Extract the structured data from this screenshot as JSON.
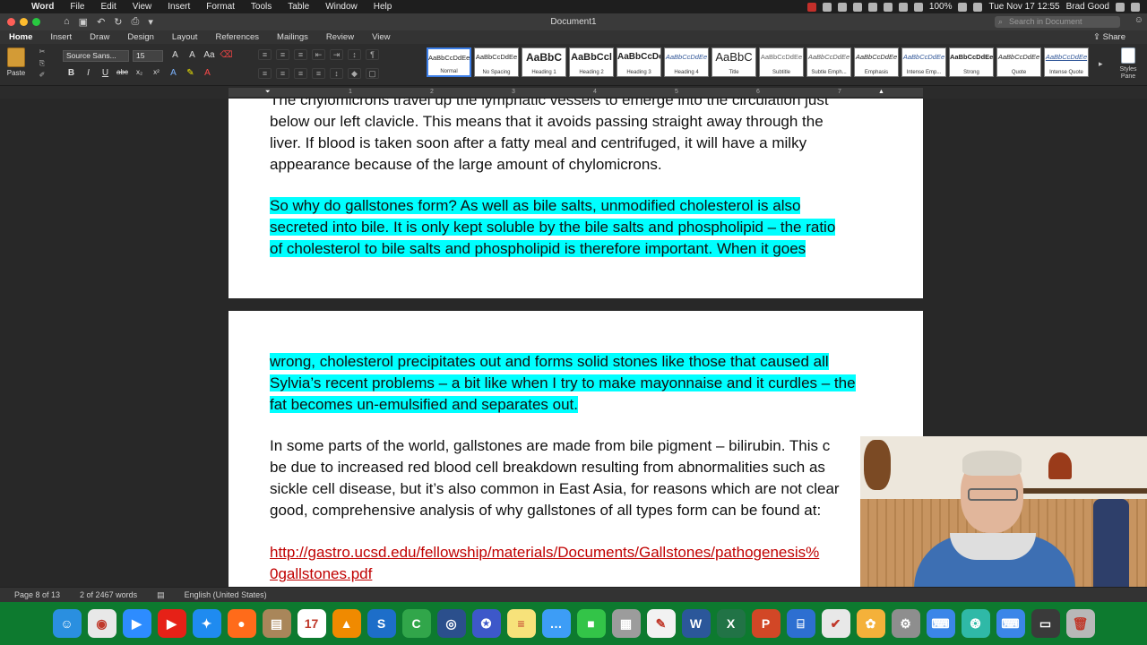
{
  "menubar": {
    "app": "Word",
    "items": [
      "File",
      "Edit",
      "View",
      "Insert",
      "Format",
      "Tools",
      "Table",
      "Window",
      "Help"
    ],
    "battery": "100%",
    "clock": "Tue Nov 17  12:55",
    "user": "Brad Good"
  },
  "titlebar": {
    "title": "Document1",
    "search_placeholder": "Search in Document"
  },
  "ribbon": {
    "tabs": [
      "Home",
      "Insert",
      "Draw",
      "Design",
      "Layout",
      "References",
      "Mailings",
      "Review",
      "View"
    ],
    "active_tab": "Home",
    "share": "Share",
    "paste": "Paste",
    "font_name": "Source Sans...",
    "font_size": "15",
    "format_buttons": [
      "B",
      "I",
      "U",
      "abc",
      "x₂",
      "x²",
      "A",
      "✎",
      "A"
    ],
    "styles": [
      {
        "sample": "AaBbCcDdEe",
        "name": "Normal"
      },
      {
        "sample": "AaBbCcDdEe",
        "name": "No Spacing"
      },
      {
        "sample": "AaBbC",
        "name": "Heading 1"
      },
      {
        "sample": "AaBbCcl",
        "name": "Heading 2"
      },
      {
        "sample": "AaBbCcDc",
        "name": "Heading 3"
      },
      {
        "sample": "AaBbCcDdEe",
        "name": "Heading 4"
      },
      {
        "sample": "AaBbC",
        "name": "Title"
      },
      {
        "sample": "AaBbCcDdEe",
        "name": "Subtitle"
      },
      {
        "sample": "AaBbCcDdEe",
        "name": "Subtle Emph..."
      },
      {
        "sample": "AaBbCcDdEe",
        "name": "Emphasis"
      },
      {
        "sample": "AaBbCcDdEe",
        "name": "Intense Emp..."
      },
      {
        "sample": "AaBbCcDdEe",
        "name": "Strong"
      },
      {
        "sample": "AaBbCcDdEe",
        "name": "Quote"
      },
      {
        "sample": "AaBbCcDdEe",
        "name": "Intense Quote"
      }
    ],
    "styles_pane": "Styles Pane"
  },
  "ruler": {
    "ticks": [
      "1",
      "2",
      "3",
      "4",
      "5",
      "6",
      "7"
    ]
  },
  "document": {
    "p1_line1": "The chylomicrons travel up the lymphatic vessels to emerge into the circulation just",
    "p1_line2": "below our left clavicle. This means that it avoids passing straight away through the",
    "p1_line3": "liver. If blood is taken soon after a fatty meal and centrifuged, it will have a milky",
    "p1_line4": "appearance because of the large amount of chylomicrons.",
    "p2_line1": "So why do gallstones form? As well as bile salts, unmodified cholesterol is also",
    "p2_line2": "secreted into bile. It is only kept soluble by the bile salts and phospholipid – the ratio",
    "p2_line3": "of cholesterol to bile salts and phospholipid is therefore important. When it goes",
    "p3_line1": "wrong, cholesterol precipitates out and forms solid stones like those that caused all",
    "p3_line2": "Sylvia’s recent problems – a bit like when I try to make mayonnaise and it curdles – the",
    "p3_line3": "fat becomes un-emulsified and separates out.",
    "p4_line1": "In some parts of the world, gallstones are made from bile pigment – bilirubin. This c",
    "p4_line2": "be due to increased red blood cell breakdown resulting from abnormalities such as",
    "p4_line3": "sickle cell disease, but it’s also common in East Asia, for reasons which are not clear",
    "p4_line4": "good, comprehensive analysis of why gallstones of all types form can be found at:",
    "link_line1": "http://gastro.ucsd.edu/fellowship/materials/Documents/Gallstones/pathogenesis%",
    "link_line2": "0gallstones.pdf"
  },
  "status": {
    "page": "Page 8 of 13",
    "words": "2 of 2467 words",
    "language": "English (United States)"
  },
  "dock": {
    "apps": [
      {
        "icon": "finder-icon",
        "color": "#2a8fe0",
        "glyph": "☺"
      },
      {
        "icon": "chrome-icon",
        "color": "#e8e8e8",
        "glyph": "◉"
      },
      {
        "icon": "zoom-icon",
        "color": "#2d8cff",
        "glyph": "▶"
      },
      {
        "icon": "youtube-icon",
        "color": "#e62117",
        "glyph": "▶"
      },
      {
        "icon": "safari-icon",
        "color": "#1f8bf0",
        "glyph": "✦"
      },
      {
        "icon": "firefox-icon",
        "color": "#ff6b1a",
        "glyph": "●"
      },
      {
        "icon": "archive-icon",
        "color": "#a9865a",
        "glyph": "▤"
      },
      {
        "icon": "calendar-icon",
        "color": "#ffffff",
        "glyph": "17"
      },
      {
        "icon": "vlc-icon",
        "color": "#f08a00",
        "glyph": "▲"
      },
      {
        "icon": "slides-icon",
        "color": "#1d6ec9",
        "glyph": "S"
      },
      {
        "icon": "camtasia-icon",
        "color": "#31a64a",
        "glyph": "C"
      },
      {
        "icon": "quicktime-icon",
        "color": "#2b4f8c",
        "glyph": "◎"
      },
      {
        "icon": "badge-icon",
        "color": "#3d58c9",
        "glyph": "✪"
      },
      {
        "icon": "notes-icon",
        "color": "#f7e27a",
        "glyph": "≡"
      },
      {
        "icon": "messages-icon",
        "color": "#3d9df6",
        "glyph": "…"
      },
      {
        "icon": "facetime-icon",
        "color": "#33c448",
        "glyph": "■"
      },
      {
        "icon": "calculator-icon",
        "color": "#9c9c9c",
        "glyph": "▦"
      },
      {
        "icon": "textedit-icon",
        "color": "#f2f2f2",
        "glyph": "✎"
      },
      {
        "icon": "word-icon",
        "color": "#2b579a",
        "glyph": "W"
      },
      {
        "icon": "excel-icon",
        "color": "#217346",
        "glyph": "X"
      },
      {
        "icon": "powerpoint-icon",
        "color": "#d24726",
        "glyph": "P"
      },
      {
        "icon": "scanner-icon",
        "color": "#2d6fd1",
        "glyph": "⌸"
      },
      {
        "icon": "tasks-icon",
        "color": "#e8e8e8",
        "glyph": "✔"
      },
      {
        "icon": "photos-icon",
        "color": "#f4b13a",
        "glyph": "✿"
      },
      {
        "icon": "preferences-icon",
        "color": "#8e8e8e",
        "glyph": "⚙"
      },
      {
        "icon": "keyboard-icon",
        "color": "#3b86e8",
        "glyph": "⌨"
      },
      {
        "icon": "brain-icon",
        "color": "#2fb9a7",
        "glyph": "❂"
      },
      {
        "icon": "keyboard-viewer-icon",
        "color": "#3b86e8",
        "glyph": "⌨"
      },
      {
        "icon": "screen-icon",
        "color": "#3a3a3a",
        "glyph": "▭"
      },
      {
        "icon": "trash-icon",
        "color": "#b8b8b8",
        "glyph": "🗑"
      }
    ]
  }
}
